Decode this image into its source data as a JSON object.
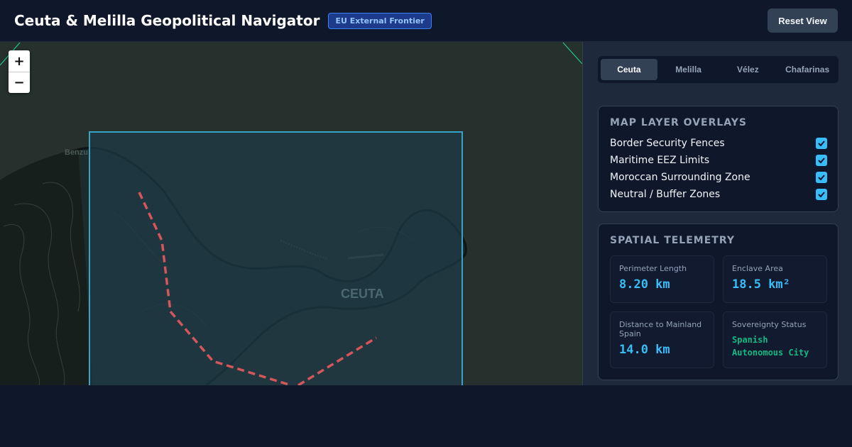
{
  "header": {
    "title": "Ceuta & Melilla Geopolitical Navigator",
    "badge": "EU External Frontier",
    "reset_label": "Reset View"
  },
  "map": {
    "zoom_in": "+",
    "zoom_out": "−",
    "town_label": "Benzu",
    "city_label": "CEUTA",
    "colors": {
      "land": "#26302d",
      "enclave_fill": "#1e3a46",
      "enclave_border": "#38a3c7",
      "fence": "#d4565b",
      "frontier_lines": "#22c58f"
    }
  },
  "tabs": [
    {
      "label": "Ceuta",
      "active": true
    },
    {
      "label": "Melilla",
      "active": false
    },
    {
      "label": "Vélez",
      "active": false
    },
    {
      "label": "Chafarinas",
      "active": false
    }
  ],
  "layers": {
    "title": "MAP LAYER OVERLAYS",
    "items": [
      {
        "label": "Border Security Fences",
        "checked": true
      },
      {
        "label": "Maritime EEZ Limits",
        "checked": true
      },
      {
        "label": "Moroccan Surrounding Zone",
        "checked": true
      },
      {
        "label": "Neutral / Buffer Zones",
        "checked": true
      }
    ]
  },
  "telemetry": {
    "title": "SPATIAL TELEMETRY",
    "perimeter": {
      "label": "Perimeter Length",
      "value": "8.20 km"
    },
    "area": {
      "label": "Enclave Area",
      "value": "18.5 km²"
    },
    "distance": {
      "label": "Distance to Mainland Spain",
      "value": "14.0 km"
    },
    "status": {
      "label": "Sovereignty Status",
      "value": "Spanish Autonomous City"
    }
  },
  "colors": {
    "accent": "#38bdf8",
    "status_ok": "#10b981",
    "badge_bg": "#1e3a8a"
  }
}
